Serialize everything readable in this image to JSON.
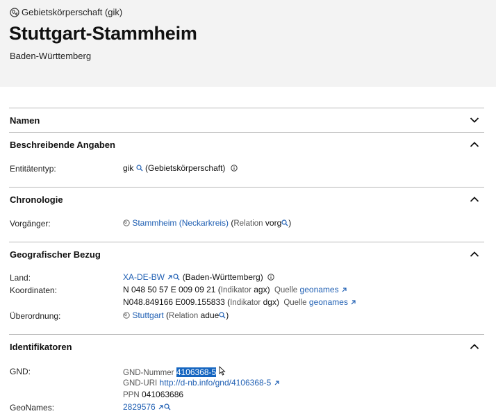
{
  "header": {
    "entity_type": "Gebietskörperschaft (gik)",
    "title": "Stuttgart-Stammheim",
    "subtitle": "Baden-Württemberg"
  },
  "sections": {
    "namen": {
      "title": "Namen"
    },
    "beschreibende": {
      "title": "Beschreibende Angaben",
      "entitaetentyp": {
        "label": "Entitätentyp:",
        "code": "gik",
        "text": "(Gebietskörperschaft)"
      }
    },
    "chronologie": {
      "title": "Chronologie",
      "vorgaenger": {
        "label": "Vorgänger:",
        "link": "Stammheim (Neckarkreis)",
        "relation_label": "Relation",
        "relation_value": "vorg"
      }
    },
    "geografisch": {
      "title": "Geografischer Bezug",
      "land": {
        "label": "Land:",
        "code": "XA-DE-BW",
        "text": "(Baden-Württemberg)"
      },
      "koordinaten": {
        "label": "Koordinaten:",
        "rows": [
          {
            "value": "N 048 50 57 E 009 09 21",
            "indicator_label": "Indikator",
            "indicator": "agx",
            "source_label": "Quelle",
            "source": "geonames"
          },
          {
            "value": "N048.849166 E009.155833",
            "indicator_label": "Indikator",
            "indicator": "dgx",
            "source_label": "Quelle",
            "source": "geonames"
          }
        ]
      },
      "ueberordnung": {
        "label": "Überordnung:",
        "link": "Stuttgart",
        "relation_label": "Relation",
        "relation_value": "adue"
      }
    },
    "identifikatoren": {
      "title": "Identifikatoren",
      "gnd": {
        "label": "GND:",
        "nummer_label": "GND-Nummer",
        "nummer": "4106368-5",
        "uri_label": "GND-URI",
        "uri": "http://d-nb.info/gnd/4106368-5",
        "ppn_label": "PPN",
        "ppn": "041063686"
      },
      "geonames": {
        "label": "GeoNames:",
        "value": "2829576"
      }
    }
  },
  "colors": {
    "link": "#1f5fb3",
    "header_bg": "#f3f3f3",
    "selection": "#1565c0"
  }
}
